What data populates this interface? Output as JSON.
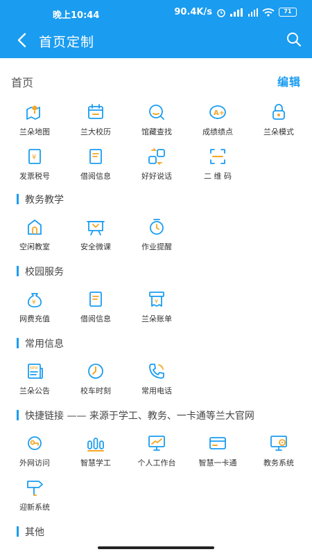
{
  "status_bar": {
    "time": "晚上10:44",
    "speed": "90.4K/s",
    "battery": "71"
  },
  "nav": {
    "title": "首页定制"
  },
  "home": {
    "heading": "首页",
    "edit_label": "编辑",
    "items": [
      {
        "label": "兰朵地图",
        "icon": "map-icon"
      },
      {
        "label": "兰大校历",
        "icon": "calendar-icon"
      },
      {
        "label": "馆藏查找",
        "icon": "search-book-icon"
      },
      {
        "label": "成绩绩点",
        "icon": "grade-icon"
      },
      {
        "label": "兰朵模式",
        "icon": "lock-icon"
      },
      {
        "label": "发票税号",
        "icon": "invoice-icon"
      },
      {
        "label": "借阅信息",
        "icon": "book-icon"
      },
      {
        "label": "好好说话",
        "icon": "translate-icon"
      },
      {
        "label": "二 维 码",
        "icon": "qrcode-scan-icon"
      }
    ]
  },
  "sections": [
    {
      "title": "教务教学",
      "items": [
        {
          "label": "空闲教室",
          "icon": "classroom-icon"
        },
        {
          "label": "安全微课",
          "icon": "lecture-icon"
        },
        {
          "label": "作业提醒",
          "icon": "alarm-icon"
        }
      ]
    },
    {
      "title": "校园服务",
      "items": [
        {
          "label": "网费充值",
          "icon": "money-bag-icon"
        },
        {
          "label": "借阅信息",
          "icon": "book-icon"
        },
        {
          "label": "兰朵账单",
          "icon": "bill-icon"
        }
      ]
    },
    {
      "title": "常用信息",
      "items": [
        {
          "label": "兰朵公告",
          "icon": "news-icon"
        },
        {
          "label": "校车时刻",
          "icon": "clock-icon"
        },
        {
          "label": "常用电话",
          "icon": "phone-icon"
        }
      ]
    },
    {
      "title": "快捷链接 —— 来源于学工、教务、一卡通等兰大官网",
      "items": [
        {
          "label": "外网访问",
          "icon": "key-icon"
        },
        {
          "label": "智慧学工",
          "icon": "stats-icon"
        },
        {
          "label": "个人工作台",
          "icon": "monitor-icon"
        },
        {
          "label": "智慧一卡通",
          "icon": "card-icon"
        },
        {
          "label": "教务系统",
          "icon": "system-settings-icon"
        },
        {
          "label": "迎新系统",
          "icon": "signpost-icon"
        }
      ]
    },
    {
      "title": "其他",
      "items": []
    }
  ],
  "colors": {
    "brand": "#1a9cf0",
    "icon_accent": "#f5a623"
  }
}
